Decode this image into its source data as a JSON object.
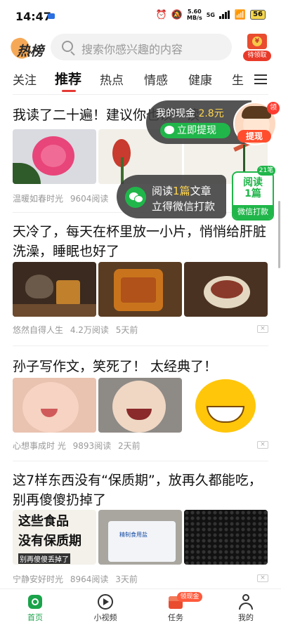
{
  "status_bar": {
    "time": "14:47",
    "net_speed_value": "5.60",
    "net_speed_unit": "MB/s",
    "signal": "5G",
    "battery": "56"
  },
  "header": {
    "logo_text": "热榜",
    "search_placeholder": "搜索你感兴趣的内容",
    "redpack_label": "待领取"
  },
  "tabs": {
    "items": [
      "关注",
      "推荐",
      "热点",
      "情感",
      "健康",
      "生"
    ],
    "active": "推荐"
  },
  "float_cash": {
    "label": "我的现金",
    "amount": "2.8元",
    "withdraw": "立即提现",
    "tixian": "提现",
    "ling": "领"
  },
  "float_read": {
    "line1_a": "阅读",
    "line1_b": "1篇",
    "line1_c": "文章",
    "line2": "立得微信打款",
    "card_top": "阅读",
    "card_mid": "1篇",
    "card_bottom": "微信打款",
    "count": "21笔"
  },
  "articles": [
    {
      "title": "我读了二十遍！建议你也读一读",
      "author": "温暖如春时光",
      "reads": "9604阅读",
      "time": ""
    },
    {
      "title": "天冷了，每天在杯里放一小片，悄悄给肝脏洗澡，睡眠也好了",
      "author": "悠然自得人生",
      "reads": "4.2万阅读",
      "time": "5天前"
    },
    {
      "title": "孙子写作文，笑死了！ 太经典了！",
      "author": "心想事成时 光",
      "reads": "9893阅读",
      "time": "2天前"
    },
    {
      "title": "这7样东西没有“保质期”，放再久都能吃，别再傻傻扔掉了",
      "author": "宁静安好时光",
      "reads": "8964阅读",
      "time": "3天前",
      "img_text_1": "这些食品",
      "img_text_2": "没有保质期",
      "img_text_3": "别再傻傻丢掉了",
      "img_text_4": "精制食用盐"
    }
  ],
  "bottom_nav": {
    "items": [
      "首页",
      "小视频",
      "任务",
      "我的"
    ],
    "active": "首页",
    "task_badge": "领现金"
  },
  "colors": {
    "accent_red": "#e53935",
    "wechat_green": "#20b64a",
    "active_nav": "#1aa34a"
  }
}
